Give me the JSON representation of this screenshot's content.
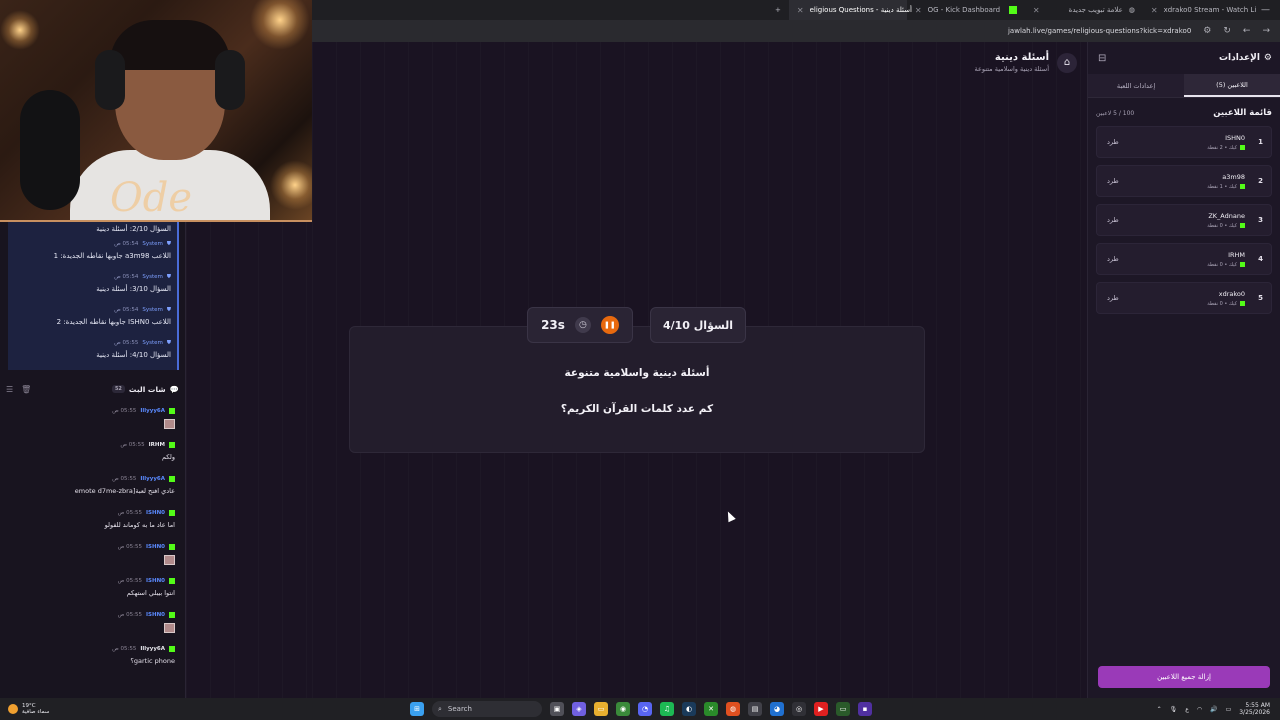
{
  "browser": {
    "tabs": [
      {
        "label": "+",
        "active": false
      },
      {
        "label": "eligious Questions - أسئلة دينية",
        "active": true
      },
      {
        "label": "OG - Kick Dashboard",
        "active": false
      },
      {
        "label": "علامة تبويب جديدة",
        "active": false
      },
      {
        "label": "xdrako0 Stream - Watch Li",
        "active": false
      }
    ],
    "url": "jawlah.live/games/religious-questions?kick=xdrako0"
  },
  "game": {
    "title": "أسئلة دينية",
    "subtitle": "أسئلة دينية واسلامية متنوعة",
    "question_counter": "السؤال 4/10",
    "timer": "23s",
    "category_line": "أسئلة دينية واسلامية متنوعة",
    "question": "كم عدد كلمات القرآن الكريم؟"
  },
  "settings": {
    "title": "الإعدادات",
    "tabs": [
      {
        "label": "اللاعبين (5)",
        "active": true
      },
      {
        "label": "إعدادات اللعبة",
        "active": false
      }
    ],
    "players_title": "قائمة اللاعبين",
    "players_count": "100 / 5 لاعبين",
    "players": [
      {
        "rank": "1",
        "name": "ISHN0",
        "meta": "كيك • 2 نقطة",
        "kick_label": "طرد"
      },
      {
        "rank": "2",
        "name": "a3m98",
        "meta": "كيك • 1 نقطة",
        "kick_label": "طرد"
      },
      {
        "rank": "3",
        "name": "ZK_Adnane",
        "meta": "كيك • 0 نقطة",
        "kick_label": "طرد"
      },
      {
        "rank": "4",
        "name": "IRHM",
        "meta": "كيك • 0 نقطة",
        "kick_label": "طرد"
      },
      {
        "rank": "5",
        "name": "xdrako0",
        "meta": "كيك • 0 نقطة",
        "kick_label": "طرد"
      }
    ],
    "remove_all_label": "إزالة جميع اللاعبين"
  },
  "chat": {
    "system_first": "السؤال 2/10: أسئلة دينية",
    "system_messages": [
      {
        "time": "05:54 ص",
        "user": "System",
        "text": "اللاعب a3m98 جاوبها نقاطه الجديدة: 1"
      },
      {
        "time": "05:54 ص",
        "user": "System",
        "text": "السؤال 3/10: أسئلة دينية"
      },
      {
        "time": "05:54 ص",
        "user": "System",
        "text": "اللاعب ISHN0 جاوبها نقاطه الجديدة: 2"
      },
      {
        "time": "05:55 ص",
        "user": "System",
        "text": "السؤال 4/10: أسئلة دينية"
      }
    ],
    "title": "شات البث",
    "count": "52",
    "messages": [
      {
        "time": "05:55 ص",
        "user": "Illyyy6A",
        "text": "",
        "emote": true,
        "white": false
      },
      {
        "time": "05:55 ص",
        "user": "IRHM",
        "text": "ولكم",
        "emote": false,
        "white": true
      },
      {
        "time": "05:55 ص",
        "user": "Illyyy6A",
        "text": "عادي افتح لعبة[emote d7me-zbra",
        "emote": false,
        "white": false
      },
      {
        "time": "05:55 ص",
        "user": "ISHN0",
        "text": "اما عاد ما به كوماند للفولو",
        "emote": false,
        "white": false
      },
      {
        "time": "05:55 ص",
        "user": "ISHN0",
        "text": "",
        "emote": true,
        "white": false
      },
      {
        "time": "05:55 ص",
        "user": "ISHN0",
        "text": "انتوا بيبلي استهكم",
        "emote": false,
        "white": false
      },
      {
        "time": "05:55 ص",
        "user": "ISHN0",
        "text": "",
        "emote": true,
        "white": false
      },
      {
        "time": "05:55 ص",
        "user": "Illyyy6A",
        "text": "gartic phone؟",
        "emote": false,
        "white": true
      }
    ]
  },
  "taskbar": {
    "weather_temp": "19°C",
    "weather_desc": "سماء صافية",
    "search_label": "Search",
    "time": "5:55 AM",
    "date": "3/25/2026"
  },
  "colors": {
    "accent": "#9a3ab8",
    "pause": "#e8690e",
    "kick_green": "#53fc18",
    "system_blue": "#4a6cd8"
  }
}
